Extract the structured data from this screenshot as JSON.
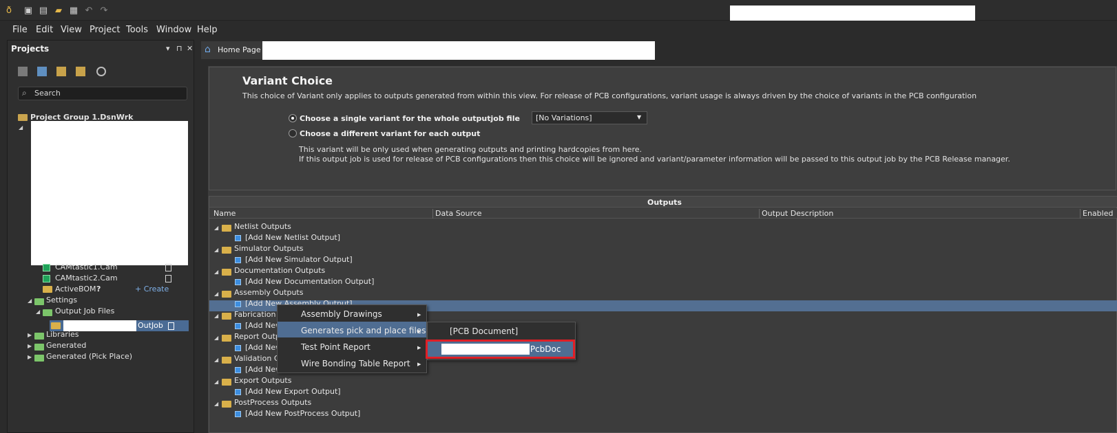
{
  "menubar": {
    "items": [
      "File",
      "Edit",
      "View",
      "Project",
      "Tools",
      "Window",
      "Help"
    ]
  },
  "projects_panel": {
    "title": "Projects",
    "header_buttons": [
      "▾",
      "⊓",
      "✕"
    ],
    "search_placeholder": "Search",
    "tree": {
      "project_group": "Project Group 1.DsnWrk",
      "cam1": "CAMtastic1.Cam",
      "cam2": "CAMtastic2.Cam",
      "activebom": "ActiveBOM",
      "activebom_help": "?",
      "create_link": "+ Create",
      "settings": "Settings",
      "output_job_files": "Output Job Files",
      "outjob_suffix": "OutJob",
      "libraries": "Libraries",
      "generated": "Generated",
      "generated_pick_place": "Generated (Pick Place)"
    }
  },
  "tabs": {
    "home_label": "Home Page"
  },
  "variant": {
    "title": "Variant Choice",
    "description": "This choice of Variant only applies to outputs generated from within this view. For release of PCB configurations, variant usage is always driven by the choice of variants in the PCB configuration",
    "option_single": "Choose a single variant for the whole outputjob file",
    "option_different": "Choose a different variant for each output",
    "selected_variant": "[No Variations]",
    "note_line1": "This variant will be only used when generating outputs and printing hardcopies from here.",
    "note_line2": "If this output job is used for release of PCB configurations then this choice will be ignored and variant/parameter information will be passed to this output job by the PCB Release manager."
  },
  "outputs": {
    "title": "Outputs",
    "columns": [
      "Name",
      "Data Source",
      "Output Description",
      "Enabled"
    ],
    "groups": [
      {
        "name": "Netlist Outputs",
        "add": "[Add New Netlist Output]"
      },
      {
        "name": "Simulator Outputs",
        "add": "[Add New Simulator Output]"
      },
      {
        "name": "Documentation Outputs",
        "add": "[Add New Documentation Output]"
      },
      {
        "name": "Assembly Outputs",
        "add": "[Add New Assembly Output]"
      },
      {
        "name": "Fabrication Outputs",
        "add": "[Add New Fabrication Output]"
      },
      {
        "name": "Report Outputs",
        "add": "[Add New Report Output]"
      },
      {
        "name": "Validation Outputs",
        "add": "[Add New Validation Output]"
      },
      {
        "name": "Export Outputs",
        "add": "[Add New Export Output]"
      },
      {
        "name": "PostProcess Outputs",
        "add": "[Add New PostProcess Output]"
      }
    ],
    "partial": {
      "fabrication": "Fabrication",
      "add_new": "[Add New",
      "report": "Report Outp",
      "validation": "Validation O"
    }
  },
  "context_menu": {
    "items": [
      "Assembly Drawings",
      "Generates pick and place files",
      "Test Point Report",
      "Wire Bonding Table Report"
    ],
    "submenu": [
      "[PCB Document]",
      ".PcbDoc"
    ]
  }
}
